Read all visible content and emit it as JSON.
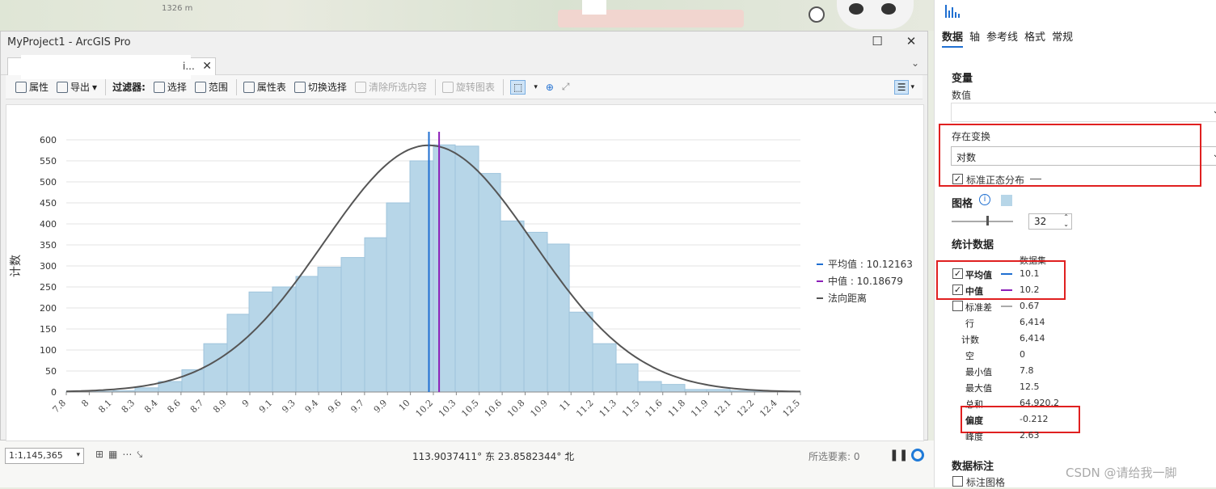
{
  "map": {
    "scale_label": "1326 m"
  },
  "window": {
    "title": "MyProject1 - ArcGIS Pro",
    "tab_label": "i...",
    "toolbar": {
      "properties": "属性",
      "export": "导出",
      "filter": "过滤器:",
      "select": "选择",
      "extent": "范围",
      "attribute_table": "属性表",
      "switch_selection": "切换选择",
      "clear_selection": "清除所选内容",
      "rotate_chart": "旋转图表"
    }
  },
  "chart_data": {
    "type": "bar",
    "ylabel": "计数",
    "ylim": [
      0,
      600
    ],
    "yticks": [
      0,
      50,
      100,
      150,
      200,
      250,
      300,
      350,
      400,
      450,
      500,
      550,
      600
    ],
    "xlim": [
      7.8,
      12.5
    ],
    "xticks": [
      "7.8",
      "8",
      "8.1",
      "8.3",
      "8.4",
      "8.6",
      "8.7",
      "8.9",
      "9",
      "9.1",
      "9.3",
      "9.4",
      "9.6",
      "9.7",
      "9.9",
      "10",
      "10.2",
      "10.3",
      "10.5",
      "10.6",
      "10.8",
      "10.9",
      "11",
      "11.2",
      "11.3",
      "11.5",
      "11.6",
      "11.8",
      "11.9",
      "12.1",
      "12.2",
      "12.4",
      "12.5"
    ],
    "bins": [
      {
        "x0": 7.8,
        "x1": 7.95,
        "count": 1
      },
      {
        "x0": 7.95,
        "x1": 8.1,
        "count": 2
      },
      {
        "x0": 8.1,
        "x1": 8.24,
        "count": 3
      },
      {
        "x0": 8.24,
        "x1": 8.39,
        "count": 10
      },
      {
        "x0": 8.39,
        "x1": 8.54,
        "count": 25
      },
      {
        "x0": 8.54,
        "x1": 8.68,
        "count": 53
      },
      {
        "x0": 8.68,
        "x1": 8.83,
        "count": 115
      },
      {
        "x0": 8.83,
        "x1": 8.97,
        "count": 185
      },
      {
        "x0": 8.97,
        "x1": 9.12,
        "count": 238
      },
      {
        "x0": 9.12,
        "x1": 9.27,
        "count": 250
      },
      {
        "x0": 9.27,
        "x1": 9.41,
        "count": 275
      },
      {
        "x0": 9.41,
        "x1": 9.56,
        "count": 297
      },
      {
        "x0": 9.56,
        "x1": 9.71,
        "count": 320
      },
      {
        "x0": 9.71,
        "x1": 9.85,
        "count": 367
      },
      {
        "x0": 9.85,
        "x1": 10.0,
        "count": 450
      },
      {
        "x0": 10.0,
        "x1": 10.15,
        "count": 550
      },
      {
        "x0": 10.15,
        "x1": 10.29,
        "count": 588
      },
      {
        "x0": 10.29,
        "x1": 10.44,
        "count": 585
      },
      {
        "x0": 10.44,
        "x1": 10.58,
        "count": 520
      },
      {
        "x0": 10.58,
        "x1": 10.73,
        "count": 407
      },
      {
        "x0": 10.73,
        "x1": 10.88,
        "count": 380
      },
      {
        "x0": 10.88,
        "x1": 11.02,
        "count": 352
      },
      {
        "x0": 11.02,
        "x1": 11.17,
        "count": 190
      },
      {
        "x0": 11.17,
        "x1": 11.32,
        "count": 115
      },
      {
        "x0": 11.32,
        "x1": 11.46,
        "count": 67
      },
      {
        "x0": 11.46,
        "x1": 11.61,
        "count": 25
      },
      {
        "x0": 11.61,
        "x1": 11.76,
        "count": 18
      },
      {
        "x0": 11.76,
        "x1": 11.9,
        "count": 6
      },
      {
        "x0": 11.9,
        "x1": 12.05,
        "count": 6
      },
      {
        "x0": 12.05,
        "x1": 12.2,
        "count": 3
      },
      {
        "x0": 12.2,
        "x1": 12.34,
        "count": 2
      },
      {
        "x0": 12.34,
        "x1": 12.5,
        "count": 1
      }
    ],
    "mean_value": 10.12163,
    "median_value": 10.18679,
    "normal_curve": {
      "mean": 10.12,
      "std": 0.67,
      "peak": 587
    },
    "legend": [
      {
        "label": "平均值 : 10.12163",
        "color": "#1f6fd1"
      },
      {
        "label": "中值 : 10.18679",
        "color": "#8b1fb8"
      },
      {
        "label": "法向距离",
        "color": "#555555"
      }
    ],
    "colors": {
      "bar_fill": "#b7d6e8",
      "bar_stroke": "#9fc4dc",
      "curve": "#555555"
    }
  },
  "status": {
    "scale": "1:1,145,365",
    "coordinates": "113.9037411° 东 23.8582344° 北",
    "selected_features": "所选要素: 0"
  },
  "panel": {
    "tabs": [
      "数据",
      "轴",
      "参考线",
      "格式",
      "常规"
    ],
    "variables_title": "变量",
    "value_label": "数值",
    "transform_label": "存在变换",
    "transform_value": "对数",
    "normal_label": "标准正态分布",
    "bins_title": "图格",
    "bins_value": "32",
    "stats_title": "统计数据",
    "dataset_header": "数据集",
    "stats": [
      {
        "label": "平均值",
        "value": "10.1",
        "checked": true
      },
      {
        "label": "中值",
        "value": "10.2",
        "checked": true
      },
      {
        "label": "标准差",
        "value": "0.67",
        "checked": false
      },
      {
        "label": "行",
        "value": "6,414"
      },
      {
        "label": "计数",
        "value": "6,414"
      },
      {
        "label": "空",
        "value": "0"
      },
      {
        "label": "最小值",
        "value": "7.8"
      },
      {
        "label": "最大值",
        "value": "12.5"
      },
      {
        "label": "总和",
        "value": "64,920.2"
      },
      {
        "label": "偏度",
        "value": "-0.212"
      },
      {
        "label": "峰度",
        "value": "2.63"
      }
    ],
    "labels_title": "数据标注",
    "label_bins": "标注图格"
  },
  "watermark": "CSDN @请给我一脚"
}
